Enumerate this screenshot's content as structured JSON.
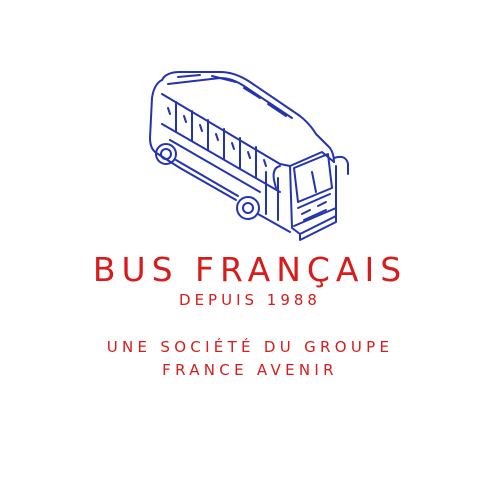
{
  "logo": {
    "icon": "bus-icon",
    "brand_name": "BUS FRANÇAIS",
    "since": "DEPUIS 1988",
    "group_line_1": "UNE SOCIÉTÉ DU GROUPE",
    "group_line_2": "FRANCE AVENIR"
  },
  "colors": {
    "background": "#ffffff",
    "text_red": "#d81b1b",
    "line_blue": "#2433b0"
  }
}
